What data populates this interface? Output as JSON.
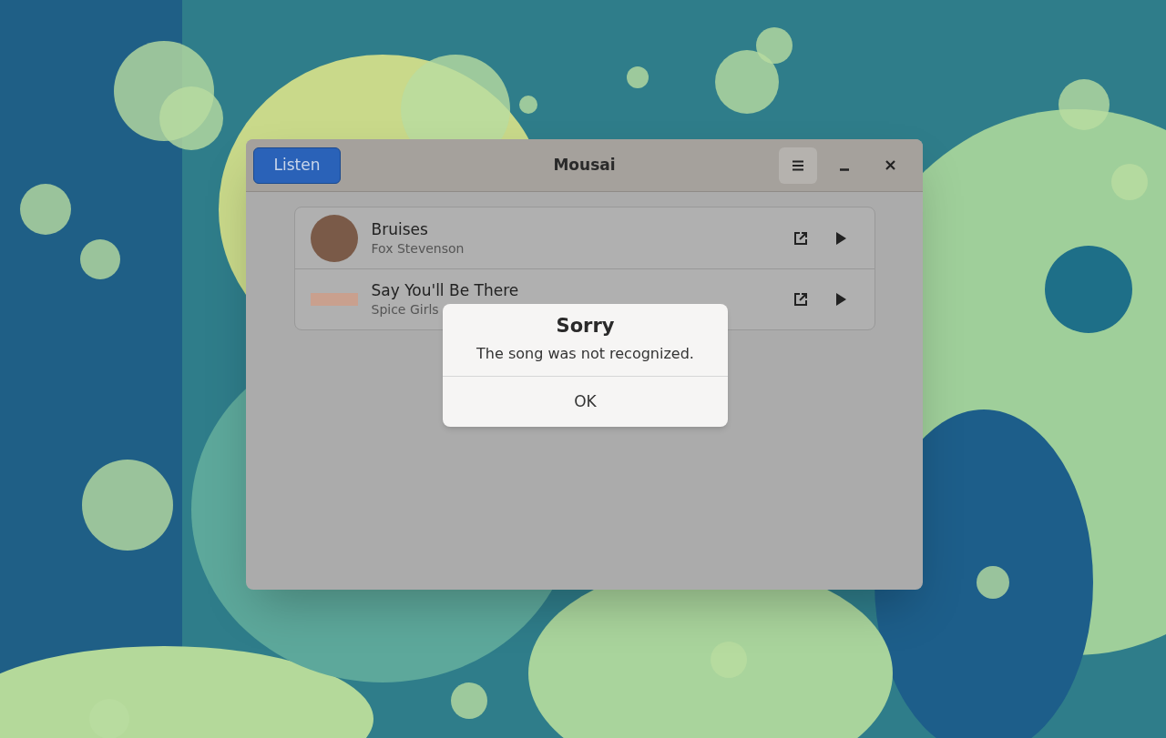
{
  "window": {
    "title": "Mousai",
    "listen_button": "Listen"
  },
  "songs": [
    {
      "title": "Bruises",
      "artist": "Fox Stevenson",
      "kind": "round"
    },
    {
      "title": "Say You'll Be There",
      "artist": "Spice Girls",
      "kind": "wide"
    }
  ],
  "dialog": {
    "title": "Sorry",
    "message": "The song was not recognized.",
    "button": "OK"
  }
}
